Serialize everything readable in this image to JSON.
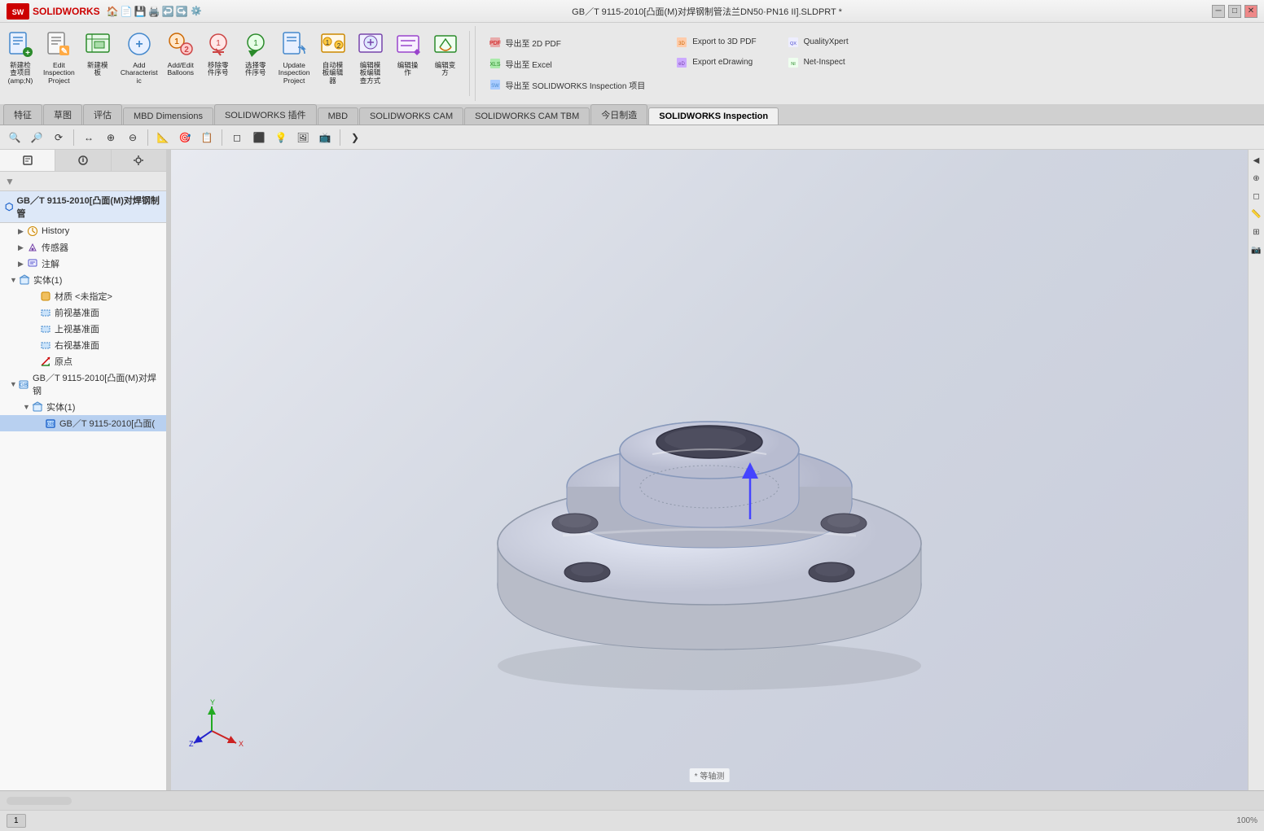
{
  "titlebar": {
    "logo": "SOLIDWORKS",
    "title": "GB／T 9115-2010[凸面(M)对焊钢制管法兰DN50·PN16 II].SLDPRT *",
    "subtitle": ""
  },
  "quickaccess": {
    "buttons": [
      "🏠",
      "📄",
      "💾",
      "🖨️",
      "↩️",
      "↪️"
    ]
  },
  "ribbon": {
    "groups": [
      {
        "name": "inspection-group",
        "buttons": [
          {
            "key": "new-inspection",
            "label": "新建检\n查项目\n(amp;N)",
            "icon": "new-insp"
          },
          {
            "key": "edit-inspection",
            "label": "Edit\nInspection\nProject",
            "icon": "edit-insp"
          },
          {
            "key": "new-model",
            "label": "新建模\n板",
            "icon": "new-model"
          },
          {
            "key": "add-char",
            "label": "Add\nCharacteristic",
            "icon": "add-char"
          },
          {
            "key": "add-edit-balloon",
            "label": "Add/Edit\nBalloons",
            "icon": "add-balloon"
          },
          {
            "key": "remove-part",
            "label": "移除零\n件序号",
            "icon": "remove-part"
          },
          {
            "key": "select-part",
            "label": "选择零\n件序号",
            "icon": "select-part"
          },
          {
            "key": "update-insp",
            "label": "Update\nInspection\nProject",
            "icon": "update-insp"
          },
          {
            "key": "auto-balloon",
            "label": "自动模\n板编辑\n器",
            "icon": "auto-balloon"
          },
          {
            "key": "edit-balloon-view",
            "label": "编辑模\n板编辑\n查方式",
            "icon": "edit-balloon"
          },
          {
            "key": "edit-op",
            "label": "编辑操\n作",
            "icon": "edit-op"
          },
          {
            "key": "edit-change",
            "label": "编辑变\n方",
            "icon": "edit-change"
          }
        ]
      }
    ],
    "right_buttons": [
      {
        "key": "export-2dpdf",
        "label": "导出至 2D PDF"
      },
      {
        "key": "export-excel",
        "label": "导出至 Excel"
      },
      {
        "key": "export-sw-insp",
        "label": "导出至 SOLIDWORKS Inspection 项目"
      },
      {
        "key": "export-3dpdf",
        "label": "Export to 3D PDF"
      },
      {
        "key": "export-edrawing",
        "label": "Export eDrawing"
      },
      {
        "key": "quality-xpert",
        "label": "QualityXpert"
      },
      {
        "key": "net-inspect",
        "label": "Net-Inspect"
      }
    ]
  },
  "tabs": [
    {
      "key": "feature",
      "label": "特征",
      "active": false
    },
    {
      "key": "drawing",
      "label": "草图",
      "active": false
    },
    {
      "key": "evaluate",
      "label": "评估",
      "active": false
    },
    {
      "key": "mbd-dimensions",
      "label": "MBD Dimensions",
      "active": false
    },
    {
      "key": "sw-plugins",
      "label": "SOLIDWORKS 插件",
      "active": false
    },
    {
      "key": "mbd",
      "label": "MBD",
      "active": false
    },
    {
      "key": "sw-cam",
      "label": "SOLIDWORKS CAM",
      "active": false
    },
    {
      "key": "sw-cam-tbm",
      "label": "SOLIDWORKS CAM TBM",
      "active": false
    },
    {
      "key": "today-manufacturing",
      "label": "今日制造",
      "active": false
    },
    {
      "key": "sw-inspection",
      "label": "SOLIDWORKS Inspection",
      "active": true
    }
  ],
  "subtoolbar": {
    "buttons": [
      "🔍",
      "🔎",
      "⟳",
      "↔",
      "⊕",
      "⊖",
      "📐",
      "🎯",
      "📋",
      "🔶",
      "◻",
      "🔷",
      "🔸",
      "⬡"
    ]
  },
  "feature_tree": {
    "root_label": "GB／T 9115-2010[凸面(M)对焊钢制管",
    "items": [
      {
        "key": "history",
        "label": "History",
        "icon": "clock",
        "indent": 1,
        "expand": false
      },
      {
        "key": "sensors",
        "label": "传感器",
        "icon": "sensor",
        "indent": 1,
        "expand": false
      },
      {
        "key": "annotations",
        "label": "注解",
        "icon": "annotation",
        "indent": 1,
        "expand": false
      },
      {
        "key": "solid1",
        "label": "实体(1)",
        "icon": "solid",
        "indent": 1,
        "expand": true
      },
      {
        "key": "material",
        "label": "材质 <未指定>",
        "icon": "material",
        "indent": 2
      },
      {
        "key": "front-plane",
        "label": "前视基准面",
        "icon": "plane",
        "indent": 2
      },
      {
        "key": "top-plane",
        "label": "上视基准面",
        "icon": "plane",
        "indent": 2
      },
      {
        "key": "right-plane",
        "label": "右视基准面",
        "icon": "plane",
        "indent": 2
      },
      {
        "key": "origin",
        "label": "原点",
        "icon": "origin",
        "indent": 2
      },
      {
        "key": "part-ref",
        "label": "GB／T 9115-2010[凸面(M)对焊钢",
        "icon": "part-ref",
        "indent": 2,
        "expand": true
      },
      {
        "key": "solid2",
        "label": "实体(1)",
        "icon": "solid",
        "indent": 3,
        "expand": false
      },
      {
        "key": "part-item",
        "label": "GB／T 9115-2010[凸面(",
        "icon": "part-item",
        "indent": 4,
        "selected": true
      }
    ]
  },
  "viewport": {
    "view_label": "* 等轴测"
  },
  "status_bar": {
    "left": "",
    "right": ""
  }
}
